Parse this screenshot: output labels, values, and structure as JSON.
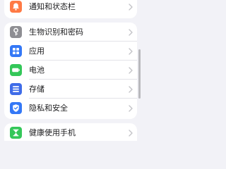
{
  "settings": {
    "top_item": {
      "label": "通知和状态栏",
      "icon": "bell-icon",
      "color": "#ff7a45"
    },
    "group_main": [
      {
        "label": "生物识别和密码",
        "icon": "key-icon",
        "color": "#8e8e93"
      },
      {
        "label": "应用",
        "icon": "apps-grid-icon",
        "color": "#3478f6"
      },
      {
        "label": "电池",
        "icon": "battery-icon",
        "color": "#34c759"
      },
      {
        "label": "存储",
        "icon": "storage-list-icon",
        "color": "#3f6ce8"
      },
      {
        "label": "隐私和安全",
        "icon": "shield-check-icon",
        "color": "#3478f6"
      }
    ],
    "bottom_item": {
      "label": "健康使用手机",
      "icon": "hourglass-icon",
      "color": "#34c759"
    }
  }
}
